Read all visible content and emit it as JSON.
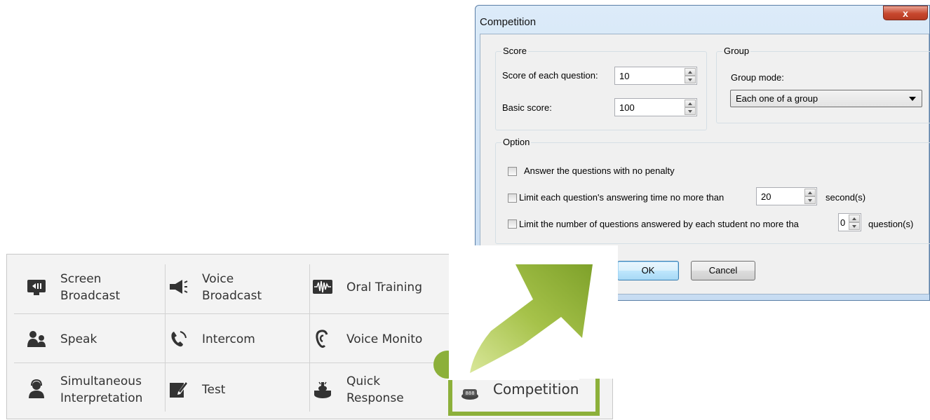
{
  "dialog": {
    "title": "Competition",
    "close_glyph": "x",
    "score_group": {
      "title": "Score",
      "score_each_label": "Score of each question:",
      "score_each_value": "10",
      "basic_label": "Basic score:",
      "basic_value": "100"
    },
    "group_group": {
      "title": "Group",
      "mode_label": "Group mode:",
      "mode_value": "Each one of a group"
    },
    "option_group": {
      "title": "Option",
      "opt1": "Answer the questions with no penalty",
      "opt2_prefix": "Limit each question's answering time no more than",
      "opt2_value": "20",
      "opt2_suffix": "second(s)",
      "opt3_prefix": "Limit the number of questions answered by each student no more tha",
      "opt3_value": "0",
      "opt3_suffix": "question(s)"
    },
    "ok_label": "OK",
    "cancel_label": "Cancel"
  },
  "toolbar": {
    "screen_broadcast": [
      "Screen",
      "Broadcast"
    ],
    "voice_broadcast": [
      "Voice",
      "Broadcast"
    ],
    "oral_training": "Oral Training",
    "speak": "Speak",
    "intercom": "Intercom",
    "voice_monitor": "Voice Monito",
    "simultaneous": [
      "Simultaneous",
      "Interpretation"
    ],
    "test": "Test",
    "quick_response": [
      "Quick",
      "Response"
    ],
    "competition": "Competition"
  },
  "colors": {
    "arrow_green": "#8cb03a",
    "dialog_frame": "#c7dcf2"
  }
}
